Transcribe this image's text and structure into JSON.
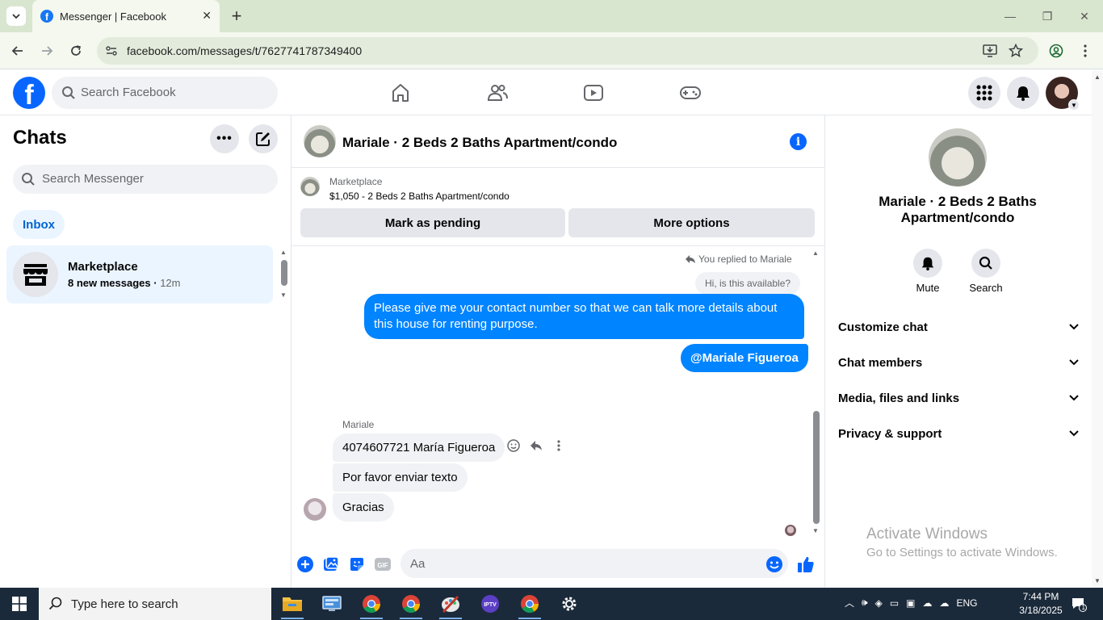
{
  "browser": {
    "tab_title": "Messenger | Facebook",
    "url": "facebook.com/messages/t/7627741787349400"
  },
  "fb_header": {
    "search_placeholder": "Search Facebook",
    "nav_icons": [
      "home-icon",
      "friends-icon",
      "video-icon",
      "gaming-icon"
    ],
    "right_icons": [
      "menu-grid-icon",
      "notifications-bell-icon",
      "profile-avatar"
    ],
    "brand_color": "#0866ff"
  },
  "sidebar": {
    "title": "Chats",
    "search_placeholder": "Search Messenger",
    "filter": "Inbox",
    "chats": [
      {
        "name": "Marketplace",
        "preview": "8 new messages",
        "time": "12m"
      }
    ]
  },
  "conversation": {
    "title": "Mariale · 2 Beds 2 Baths Apartment/condo",
    "marketplace": {
      "label": "Marketplace",
      "listing": "$1,050 - 2 Beds 2 Baths Apartment/condo",
      "mark_pending": "Mark as pending",
      "more_options": "More options"
    },
    "replied_label": "You replied to Mariale",
    "quoted_text": "Hi, is this available?",
    "outgoing": [
      "Please give me your contact number so that we can talk more details about this house for renting purpose.",
      "@Mariale Figueroa"
    ],
    "sender": "Mariale",
    "incoming": [
      "4074607721 María Figueroa",
      "Por favor enviar texto",
      "Gracias"
    ],
    "composer_placeholder": "Aa",
    "accent_color": "#0084ff"
  },
  "info_panel": {
    "name": "Mariale · 2 Beds 2 Baths Apartment/condo",
    "actions": [
      {
        "label": "Mute",
        "icon": "bell-icon"
      },
      {
        "label": "Search",
        "icon": "search-icon"
      }
    ],
    "sections": [
      "Customize chat",
      "Chat members",
      "Media, files and links",
      "Privacy & support"
    ]
  },
  "watermark": {
    "line1": "Activate Windows",
    "line2": "Go to Settings to activate Windows."
  },
  "taskbar": {
    "search_placeholder": "Type here to search",
    "language": "ENG",
    "time": "7:44 PM",
    "date": "3/18/2025",
    "notification_count": "1"
  }
}
